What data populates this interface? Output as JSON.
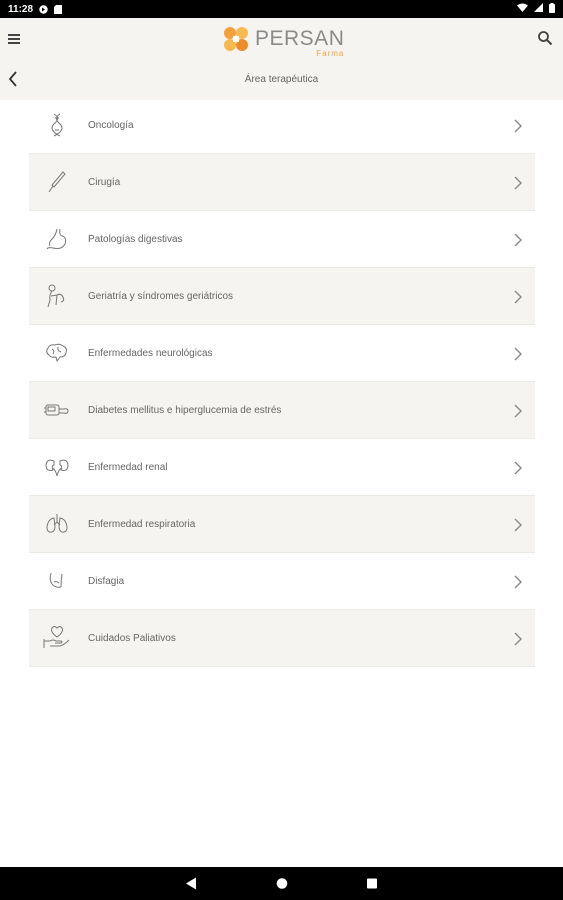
{
  "status_bar": {
    "time": "11:28"
  },
  "header": {
    "logo_name": "PERSAN",
    "logo_sub": "Farma",
    "title": "Área terapéutica"
  },
  "items": [
    {
      "label": "Oncología",
      "icon": "dna-ribbon-icon"
    },
    {
      "label": "Cirugía",
      "icon": "scalpel-icon"
    },
    {
      "label": "Patologías digestivas",
      "icon": "stomach-icon"
    },
    {
      "label": "Geriatría y síndromes geriátricos",
      "icon": "elderly-person-icon"
    },
    {
      "label": "Enfermedades neurológicas",
      "icon": "brain-icon"
    },
    {
      "label": "Diabetes mellitus e hiperglucemia de estrés",
      "icon": "glucose-meter-icon"
    },
    {
      "label": "Enfermedad renal",
      "icon": "kidneys-icon"
    },
    {
      "label": "Enfermedad respiratoria",
      "icon": "lungs-icon"
    },
    {
      "label": "Disfagia",
      "icon": "throat-icon"
    },
    {
      "label": "Cuidados Paliativos",
      "icon": "heart-hand-icon"
    }
  ],
  "colors": {
    "accent": "#f5a13b",
    "header_bg": "#f5f4f0",
    "row_alt_bg": "#f5f4f0"
  }
}
